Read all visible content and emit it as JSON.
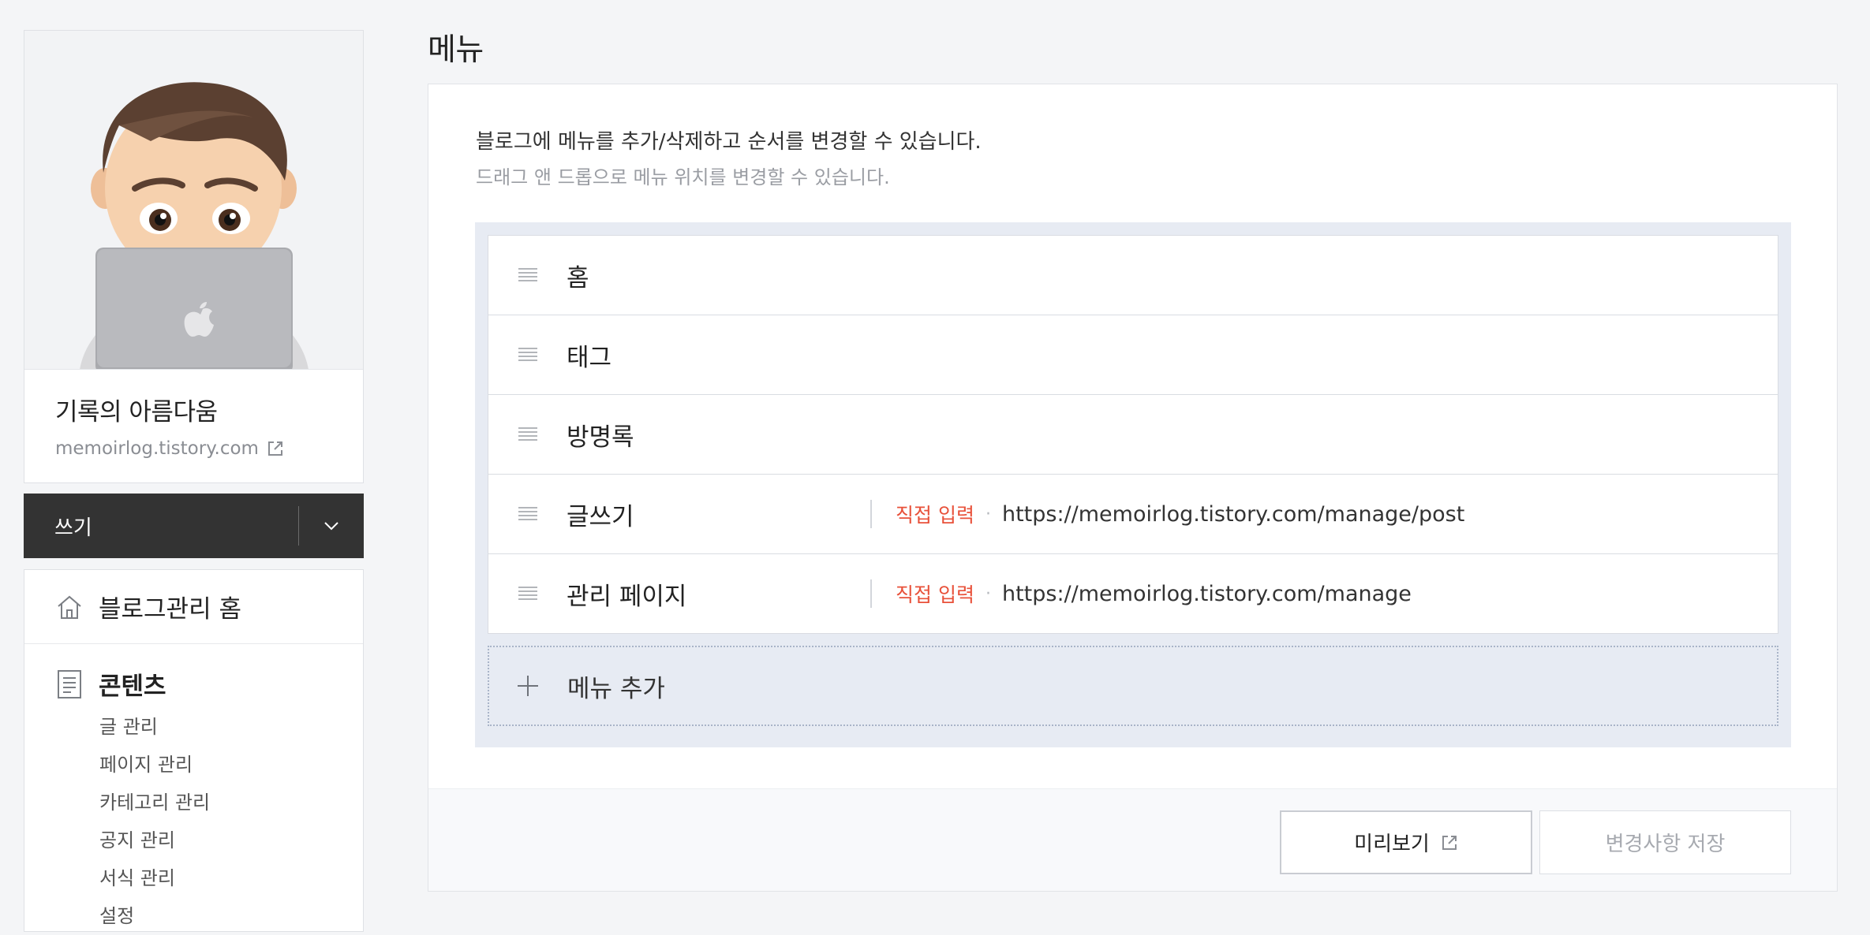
{
  "sidebar": {
    "blog_name": "기록의 아름다움",
    "blog_url": "memoirlog.tistory.com",
    "write_label": "쓰기",
    "home_label": "블로그관리 홈",
    "contents_label": "콘텐츠",
    "contents_items": [
      "글 관리",
      "페이지 관리",
      "카테고리 관리",
      "공지 관리",
      "서식 관리",
      "설정"
    ]
  },
  "main": {
    "title": "메뉴",
    "description": "블로그에 메뉴를 추가/삭제하고 순서를 변경할 수 있습니다.",
    "hint": "드래그 앤 드롭으로 메뉴 위치를 변경할 수 있습니다.",
    "menu_items": [
      {
        "label": "홈",
        "tag": "",
        "url": ""
      },
      {
        "label": "태그",
        "tag": "",
        "url": ""
      },
      {
        "label": "방명록",
        "tag": "",
        "url": ""
      },
      {
        "label": "글쓰기",
        "tag": "직접 입력",
        "url": "https://memoirlog.tistory.com/manage/post"
      },
      {
        "label": "관리 페이지",
        "tag": "직접 입력",
        "url": "https://memoirlog.tistory.com/manage"
      }
    ],
    "add_menu_label": "메뉴 추가",
    "preview_label": "미리보기",
    "save_label": "변경사항 저장"
  },
  "icons": {
    "external_link": "external-link-icon",
    "chevron": "chevron-down-icon",
    "home": "home-icon",
    "document": "document-icon",
    "drag": "drag-handle-icon",
    "plus": "plus-icon"
  },
  "colors": {
    "direct_tag": "#e8513a",
    "write_bar": "#333333",
    "menu_area": "#e7ebf3"
  }
}
